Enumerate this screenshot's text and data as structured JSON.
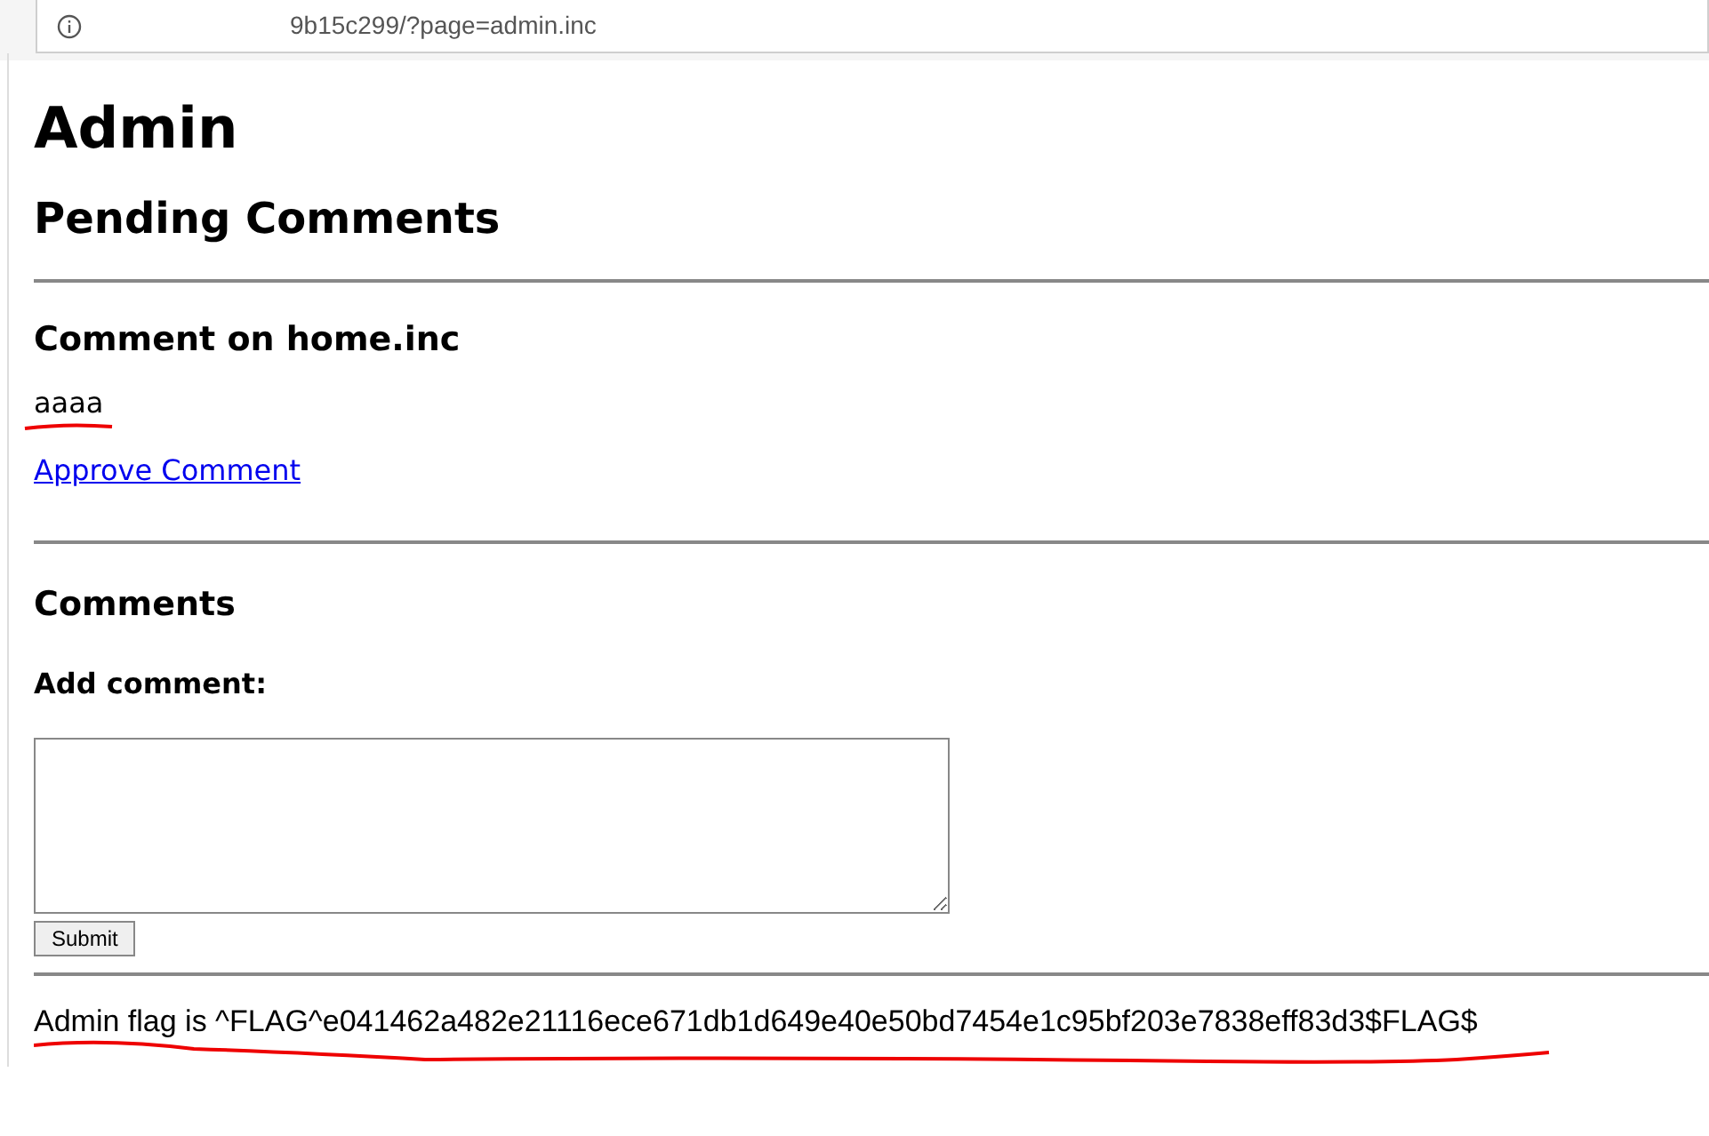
{
  "address_bar": {
    "url": "9b15c299/?page=admin.inc"
  },
  "title": "Admin",
  "pending_heading": "Pending Comments",
  "pending_comments": [
    {
      "heading": "Comment on home.inc",
      "text": "aaaa",
      "link": "Approve Comment"
    }
  ],
  "comments_heading": "Comments",
  "add_comment_label": "Add comment:",
  "submit_button": "Submit",
  "flag_text": "Admin flag is ^FLAG^e041462a482e21116ece671db1d649e40e50bd7454e1c95bf203e7838eff83d3$FLAG$"
}
